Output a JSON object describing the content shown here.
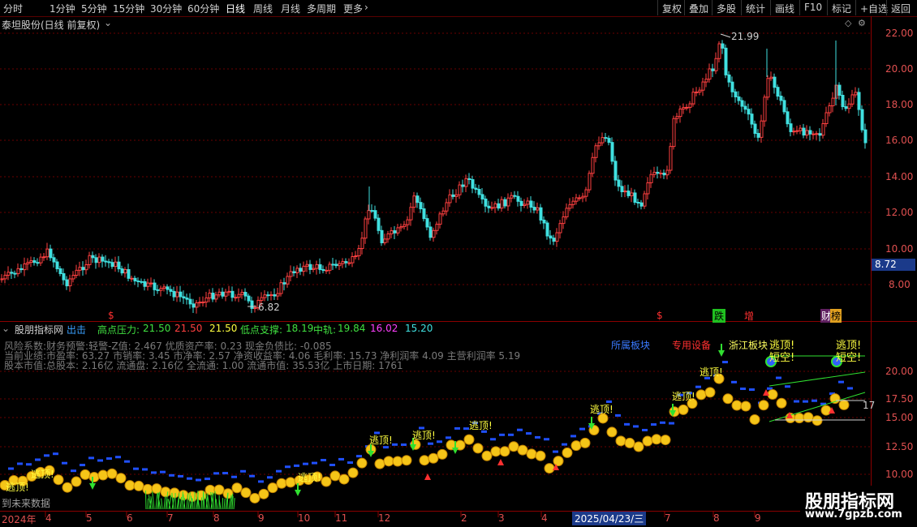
{
  "toolbar": {
    "periods": [
      "分时",
      "1分钟",
      "5分钟",
      "15分钟",
      "30分钟",
      "60分钟",
      "日线",
      "周线",
      "月线",
      "多周期",
      "更多"
    ],
    "active_period": "日线",
    "right_buttons": [
      "复权",
      "叠加",
      "多股",
      "统计",
      "画线",
      "F10",
      "标记",
      "+自选",
      "返回"
    ]
  },
  "main_chart": {
    "title": "泰坦股份(日线 前复权)",
    "y_ticks": [
      "22.00",
      "20.00",
      "18.00",
      "16.00",
      "14.00",
      "12.00",
      "10.00",
      "8.00"
    ],
    "current_price": "8.72",
    "high_label": "21.99",
    "low_label": "6.82",
    "event_marks": [
      "$",
      "$",
      "跌",
      "增",
      "财",
      "榜"
    ]
  },
  "indicator": {
    "name": "股朋指标网",
    "items": [
      {
        "label": "出击",
        "value": ""
      },
      {
        "label": "高点压力:",
        "value": "21.50"
      },
      {
        "label": "",
        "value": "21.50"
      },
      {
        "label": "",
        "value": "21.50"
      },
      {
        "label": "低点支撑:",
        "value": "18.19"
      },
      {
        "label": "中轨:",
        "value": "19.84"
      },
      {
        "label": "",
        "value": "16.02"
      },
      {
        "label": "",
        "value": "15.20"
      }
    ],
    "info_lines": [
      "风险系数:财务预警:轻警-Z值: 2.467 优质资产率: 0.23 现金负债比: -0.085",
      "当前业绩:市盈率: 63.27 市销率: 3.45 市净率: 2.57 净资收益率: 4.06 毛利率: 15.73 净利润率 4.09 主营利润率 5.19",
      "股本市值:总股本: 2.16亿 流通盘: 2.16亿 全流通: 1.00 流通市值: 35.53亿 上市日期: 1761"
    ],
    "tags": [
      "所属板块",
      "专用设备",
      "浙江板块"
    ],
    "signal_text": [
      "逃顶!",
      "短空!"
    ],
    "y_ticks": [
      "20.00",
      "17.50",
      "15.00",
      "12.50",
      "10.00"
    ],
    "right_value": "17",
    "future_text": "到未来数据"
  },
  "xaxis": {
    "labels": [
      "2024年",
      "4",
      "5",
      "6",
      "7",
      "8",
      "9",
      "10",
      "11",
      "12",
      "2",
      "3",
      "4",
      "2025/04/23/三",
      "7",
      "8",
      "9"
    ]
  },
  "watermark": {
    "title": "股朋指标网",
    "url": "www.7gpzb.com"
  }
}
